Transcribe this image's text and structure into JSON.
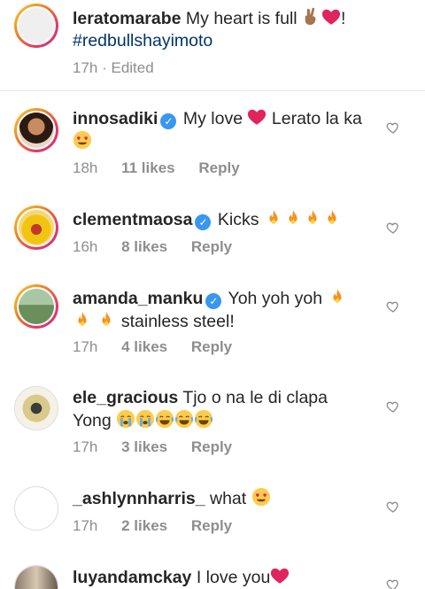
{
  "caption": {
    "username": "leratomarabe",
    "text": "My heart is full",
    "text_end": "!",
    "hashtag": "#redbullshayimoto",
    "time": "17h",
    "edited": "Edited"
  },
  "comments": [
    {
      "username": "innosadiki",
      "verified": true,
      "text_1": "My love",
      "text_2": "Lerato la ka",
      "time": "18h",
      "likes": "11 likes",
      "reply": "Reply"
    },
    {
      "username": "clementmaosa",
      "verified": true,
      "text_1": "Kicks",
      "time": "16h",
      "likes": "8 likes",
      "reply": "Reply"
    },
    {
      "username": "amanda_manku",
      "verified": true,
      "text_1": "Yoh yoh yoh",
      "text_2": "stainless steel!",
      "time": "17h",
      "likes": "4 likes",
      "reply": "Reply"
    },
    {
      "username": "ele_gracious",
      "verified": false,
      "text_1": "Tjo o na le di clapa",
      "text_2": "Yong",
      "time": "17h",
      "likes": "3 likes",
      "reply": "Reply"
    },
    {
      "username": "_ashlynnharris_",
      "verified": false,
      "text_1": "what",
      "time": "17h",
      "likes": "2 likes",
      "reply": "Reply"
    },
    {
      "username": "luyandamckay",
      "verified": false,
      "text_1": "I love you"
    }
  ],
  "icons": {
    "heart": "heart-outline-icon",
    "verified": "verified-badge-icon"
  },
  "colors": {
    "verified": "#3897f0",
    "hashtag": "#003569",
    "meta": "#8e8e8e",
    "red_heart": "#e0245e"
  }
}
